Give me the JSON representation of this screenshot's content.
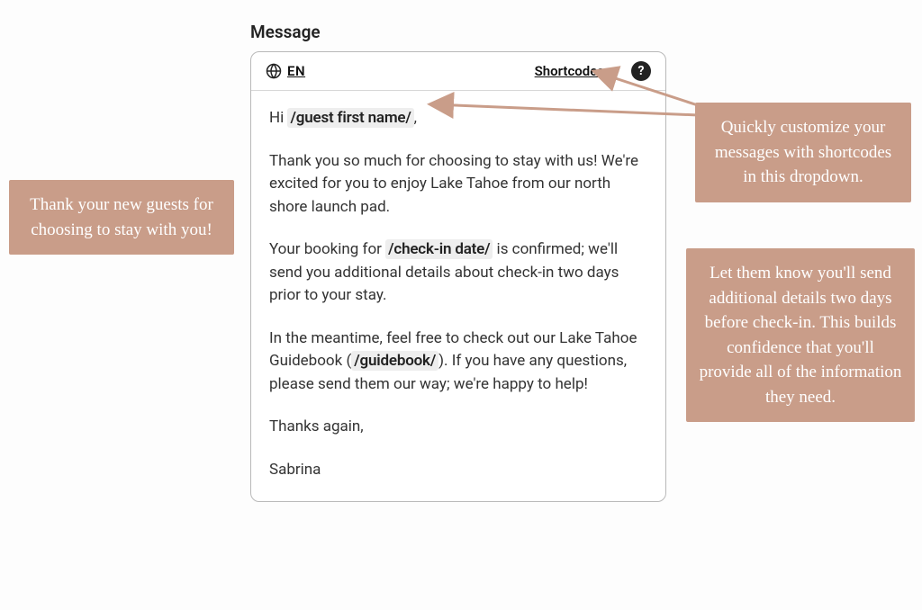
{
  "title": "Message",
  "toolbar": {
    "lang_code": "EN",
    "shortcodes_label": "Shortcodes",
    "help_symbol": "?"
  },
  "message": {
    "greeting_prefix": "Hi ",
    "greeting_token": "/guest first name/",
    "greeting_suffix": ",",
    "p1": "Thank you so much for choosing to stay with us! We're excited for you to enjoy Lake Tahoe from our north shore launch pad.",
    "p2_a": "Your booking for ",
    "p2_token": "/check-in date/",
    "p2_b": " is confirmed; we'll send you additional details about check-in two days prior to your stay.",
    "p3_a": "In the meantime, feel free to check out our Lake Tahoe Guidebook (",
    "p3_token": "/guidebook/",
    "p3_b": "). If you have any questions, please send them our way; we're happy to help!",
    "closing": "Thanks again,",
    "signature": "Sabrina"
  },
  "callouts": {
    "left": "Thank your new guests for choosing to stay with you!",
    "top_right": "Quickly customize your messages with shortcodes in this dropdown.",
    "bottom_right": "Let them know you'll send additional details two days before check-in. This builds confidence that you'll provide all of the information they need."
  },
  "colors": {
    "callout_bg": "#c99d89",
    "arrow": "#c99d89",
    "border": "#b9b9b9",
    "shortcode_bg": "#eeeeee"
  }
}
